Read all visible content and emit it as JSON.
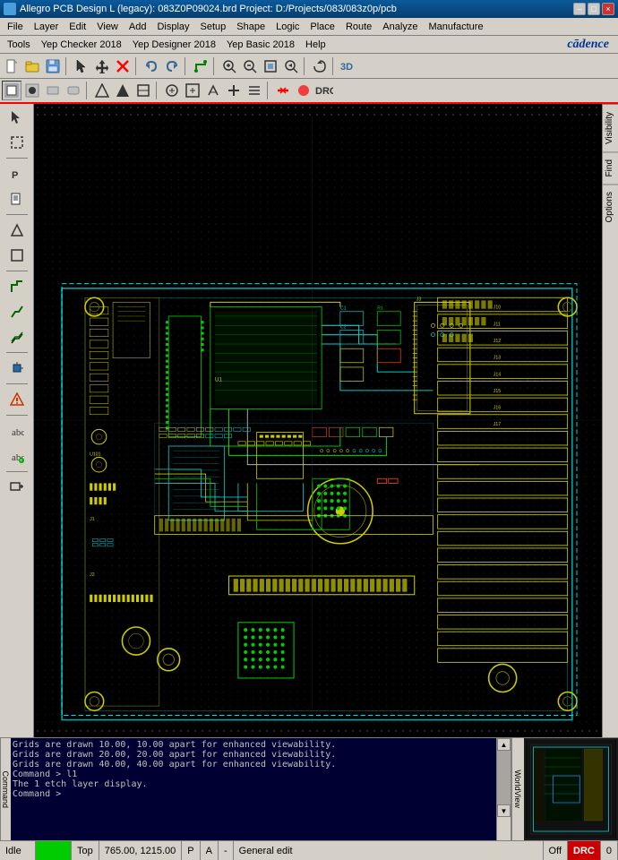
{
  "titlebar": {
    "icon": "pcb-icon",
    "title": "Allegro PCB Design L (legacy): 083Z0P09024.brd  Project: D:/Projects/083/083z0p/pcb",
    "min_label": "–",
    "max_label": "□",
    "close_label": "×"
  },
  "menus": {
    "row1": [
      "File",
      "Layer",
      "Edit",
      "View",
      "Add",
      "Display",
      "Setup",
      "Shape",
      "Logic",
      "Place",
      "Route",
      "Analyze",
      "Manufacture"
    ],
    "row2": [
      "Tools",
      "Yep Checker 2018",
      "Yep Designer 2018",
      "Yep Basic 2018",
      "Help"
    ],
    "cadence": "cādence"
  },
  "toolbar1": {
    "buttons": [
      "new",
      "open",
      "save",
      "sep",
      "pointer",
      "move",
      "rotate",
      "mirror",
      "sep",
      "delete",
      "sep",
      "undo",
      "redo",
      "sep",
      "add-connect",
      "sep",
      "zoom-in",
      "zoom-out",
      "zoom-fit",
      "zoom-prev",
      "sep",
      "redraw",
      "sep",
      "3d"
    ]
  },
  "toolbar2": {
    "buttons": [
      "snap1",
      "snap2",
      "snap3",
      "snap4",
      "sep",
      "b1",
      "b2",
      "b3",
      "sep",
      "c1",
      "c2",
      "c3",
      "c4",
      "c5",
      "sep",
      "d1",
      "d2",
      "d3",
      "sep",
      "highlight",
      "unhighlight",
      "sep",
      "check",
      "sep",
      "aaa"
    ]
  },
  "left_sidebar": {
    "buttons": [
      "select",
      "deselect",
      "sep",
      "edit",
      "property",
      "sep",
      "shape-add",
      "shape-edit",
      "sep",
      "route",
      "route-single",
      "route-diff",
      "sep",
      "place",
      "sep",
      "check",
      "sep",
      "add-text",
      "add-text2",
      "sep",
      "zoom-window"
    ]
  },
  "console": {
    "label": "Command",
    "lines": [
      "Grids are drawn 10.00, 10.00 apart for enhanced viewability.",
      "Grids are drawn 20.00, 20.00 apart for enhanced viewability.",
      "Grids are drawn 40.00, 40.00 apart for enhanced viewability.",
      "Command > l1",
      "The 1 etch layer display.",
      "Command >"
    ]
  },
  "minimap": {
    "label": "WorldView"
  },
  "right_sidebar": {
    "tabs": [
      "Visibility",
      "Find",
      "Options"
    ]
  },
  "status_bar": {
    "state": "Idle",
    "indicator": "",
    "layer": "Top",
    "coordinates": "765.00, 1215.00",
    "p_flag": "P",
    "a_flag": "A",
    "dash": "-",
    "mode": "General edit",
    "off_label": "Off",
    "drc_label": "DRC",
    "number": "0"
  }
}
